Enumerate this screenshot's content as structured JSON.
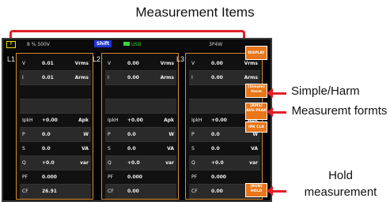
{
  "annotations": {
    "title": "Measurement Items",
    "simple_harm": "Simple/Harm",
    "formats": "Measuremt formts",
    "hold": "Hold measurement"
  },
  "status": {
    "mode": "P",
    "range": "8 % 500V",
    "shift": "Shift",
    "usb": "USB",
    "wiring": "3P4W"
  },
  "panels": [
    {
      "label": "L1",
      "rows": [
        {
          "name": "V",
          "value": "0.01",
          "unit": "Vrms"
        },
        {
          "name": "I",
          "value": "0.01",
          "unit": "Arms"
        },
        {
          "name": "",
          "value": "",
          "unit": ""
        },
        {
          "name": "",
          "value": "",
          "unit": ""
        },
        {
          "name": "IpkH",
          "value": "+0.00",
          "unit": "Apk"
        },
        {
          "name": "P",
          "value": "0.0",
          "unit": "W"
        },
        {
          "name": "S",
          "value": "0.0",
          "unit": "VA"
        },
        {
          "name": "Q",
          "value": "+0.0",
          "unit": "var"
        },
        {
          "name": "PF",
          "value": "0.000",
          "unit": ""
        },
        {
          "name": "CF",
          "value": "26.91",
          "unit": ""
        }
      ]
    },
    {
      "label": "L2",
      "rows": [
        {
          "name": "V",
          "value": "0.00",
          "unit": "Vrms"
        },
        {
          "name": "I",
          "value": "0.00",
          "unit": "Arms"
        },
        {
          "name": "",
          "value": "",
          "unit": ""
        },
        {
          "name": "",
          "value": "",
          "unit": ""
        },
        {
          "name": "IpkH",
          "value": "+0.00",
          "unit": "Apk"
        },
        {
          "name": "P",
          "value": "0.0",
          "unit": "W"
        },
        {
          "name": "S",
          "value": "0.0",
          "unit": "VA"
        },
        {
          "name": "Q",
          "value": "+0.0",
          "unit": "var"
        },
        {
          "name": "PF",
          "value": "0.000",
          "unit": ""
        },
        {
          "name": "CF",
          "value": "0.00",
          "unit": ""
        }
      ]
    },
    {
      "label": "L3",
      "rows": [
        {
          "name": "V",
          "value": "0.00",
          "unit": "Vrms"
        },
        {
          "name": "I",
          "value": "0.00",
          "unit": "Arms"
        },
        {
          "name": "",
          "value": "",
          "unit": ""
        },
        {
          "name": "",
          "value": "",
          "unit": ""
        },
        {
          "name": "IpkH",
          "value": "+0.00",
          "unit": "Apk"
        },
        {
          "name": "P",
          "value": "0.0",
          "unit": "W"
        },
        {
          "name": "S",
          "value": "0.0",
          "unit": "VA"
        },
        {
          "name": "Q",
          "value": "+0.0",
          "unit": "var"
        },
        {
          "name": "PF",
          "value": "0.000",
          "unit": ""
        },
        {
          "name": "CF",
          "value": "0.00",
          "unit": ""
        }
      ]
    }
  ],
  "softkeys": {
    "display": "DISPLAY",
    "simple": "[Simple] Harm",
    "format": "[RMS] AVG PEAK",
    "ipkclr": "IPK CLR",
    "hold": "[RUN] HOLD"
  },
  "colors": {
    "accent": "#e0202a",
    "softkey": "#e8761a",
    "panel_border": "#d98a2a"
  }
}
